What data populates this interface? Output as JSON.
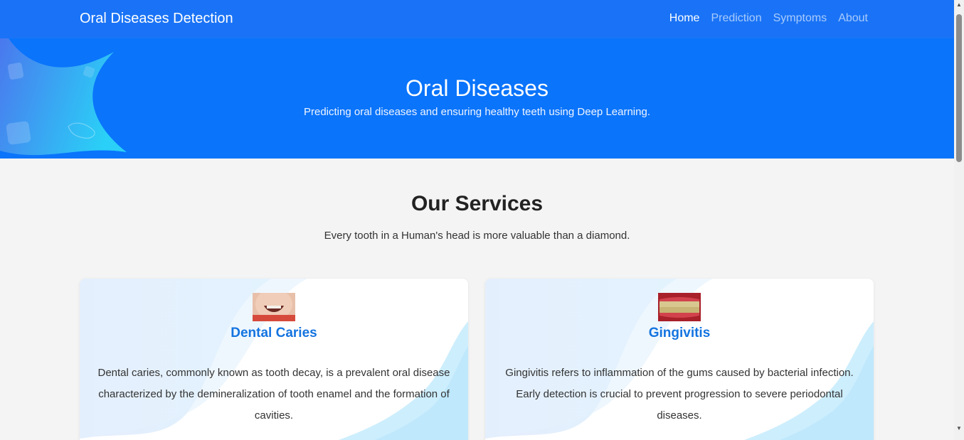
{
  "navbar": {
    "brand": "Oral Diseases Detection",
    "links": [
      "Home",
      "Prediction",
      "Symptoms",
      "About"
    ],
    "active": "Home"
  },
  "hero": {
    "title": "Oral Diseases",
    "subtitle": "Predicting oral diseases and ensuring healthy teeth using Deep Learning."
  },
  "services": {
    "title": "Our Services",
    "subtitle": "Every tooth in a Human's head is more valuable than a diamond.",
    "cards": [
      {
        "title": "Dental Caries",
        "text": "Dental caries, commonly known as tooth decay, is a prevalent oral disease characterized by the demineralization of tooth enamel and the formation of cavities.",
        "image": "child-smile-photo"
      },
      {
        "title": "Gingivitis",
        "text": "Gingivitis refers to inflammation of the gums caused by bacterial infection. Early detection is crucial to prevent progression to severe periodontal diseases.",
        "image": "inflamed-gums-photo"
      }
    ]
  },
  "colors": {
    "navbar": "#1a73f6",
    "hero": "#0a74fb",
    "accent": "#1474e0",
    "background": "#f4f4f4"
  }
}
